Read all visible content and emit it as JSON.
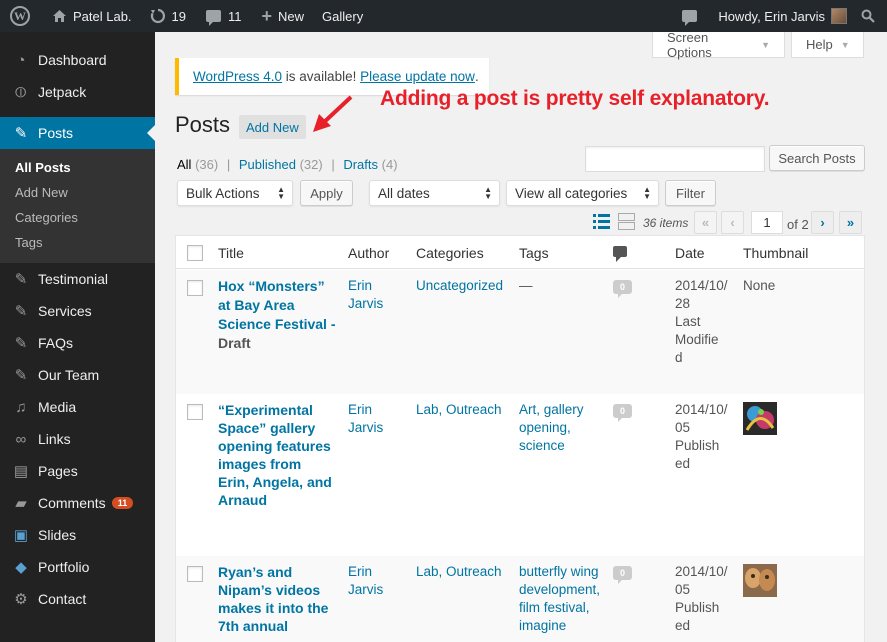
{
  "adminbar": {
    "site_name": "Patel Lab.",
    "updates_count": "19",
    "comments_count": "11",
    "new_label": "New",
    "gallery_label": "Gallery",
    "howdy": "Howdy, Erin Jarvis"
  },
  "sidebar": {
    "items": [
      {
        "label": "Dashboard",
        "icon": "dashboard-icon"
      },
      {
        "label": "Jetpack",
        "icon": "jetpack-icon"
      },
      {
        "label": "Posts",
        "icon": "pin-icon"
      },
      {
        "label": "Testimonial",
        "icon": "pin-icon"
      },
      {
        "label": "Services",
        "icon": "pin-icon"
      },
      {
        "label": "FAQs",
        "icon": "pin-icon"
      },
      {
        "label": "Our Team",
        "icon": "pin-icon"
      },
      {
        "label": "Media",
        "icon": "media-icon"
      },
      {
        "label": "Links",
        "icon": "link-icon"
      },
      {
        "label": "Pages",
        "icon": "pages-icon"
      },
      {
        "label": "Comments",
        "icon": "comments-icon",
        "badge": "11"
      },
      {
        "label": "Slides",
        "icon": "slides-icon"
      },
      {
        "label": "Portfolio",
        "icon": "portfolio-icon"
      },
      {
        "label": "Contact",
        "icon": "contact-icon"
      }
    ],
    "submenu": [
      "All Posts",
      "Add New",
      "Categories",
      "Tags"
    ]
  },
  "screen_meta": {
    "screen_options": "Screen Options",
    "help": "Help"
  },
  "notice": {
    "link1": "WordPress 4.0",
    "middle": " is available! ",
    "link2": "Please update now",
    "end": "."
  },
  "page": {
    "title": "Posts",
    "add_new": "Add New"
  },
  "annotation": "Adding a post is pretty self explanatory.",
  "filters": {
    "all": "All",
    "all_count": "(36)",
    "published": "Published",
    "published_count": "(32)",
    "drafts": "Drafts",
    "drafts_count": "(4)",
    "sep": "|",
    "search_button": "Search Posts",
    "bulk_actions": "Bulk Actions",
    "apply": "Apply",
    "all_dates": "All dates",
    "all_categories": "View all categories",
    "filter": "Filter"
  },
  "pagination": {
    "items": "36 items",
    "first": "«",
    "prev": "‹",
    "current": "1",
    "of": "of 2",
    "next": "›",
    "last": "»"
  },
  "table": {
    "headers": {
      "title": "Title",
      "author": "Author",
      "categories": "Categories",
      "tags": "Tags",
      "date": "Date",
      "thumbnail": "Thumbnail"
    },
    "rows": [
      {
        "title_lines": [
          "Hox “Monsters”",
          "at Bay Area",
          "Science Festival -"
        ],
        "state": "Draft",
        "author_lines": [
          "Erin",
          "Jarvis"
        ],
        "categories": "Uncategorized",
        "tags_lines": [
          "—"
        ],
        "comments": "0",
        "date_lines": [
          "2014/10/",
          "28",
          "Last",
          "Modifie",
          "d"
        ],
        "thumbnail": "None"
      },
      {
        "title_lines": [
          "“Experimental",
          "Space” gallery",
          "opening features",
          "images from",
          "Erin, Angela, and",
          "Arnaud"
        ],
        "author_lines": [
          "Erin",
          "Jarvis"
        ],
        "categories": "Lab, Outreach",
        "tags_lines": [
          "Art, gallery",
          "opening,",
          "science"
        ],
        "comments": "0",
        "date_lines": [
          "2014/10/",
          "05",
          "Publish",
          "ed"
        ]
      },
      {
        "title_lines": [
          "Ryan’s and",
          "Nipam’s videos",
          "makes it into the",
          "7th annual"
        ],
        "author_lines": [
          "Erin",
          "Jarvis"
        ],
        "categories": "Lab, Outreach",
        "tags_lines": [
          "butterfly wing",
          "development,",
          "film festival,",
          "imagine"
        ],
        "comments": "0",
        "date_lines": [
          "2014/10/",
          "05",
          "Publish",
          "ed"
        ]
      }
    ]
  },
  "colors": {
    "accent": "#0074a2",
    "sidebar": "#222222",
    "annotation": "#e8202a",
    "notice_border": "#ffba00"
  }
}
